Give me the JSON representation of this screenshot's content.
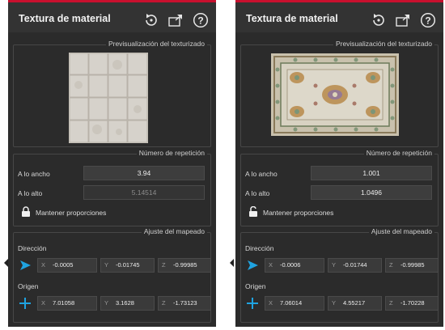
{
  "accent_color": "#c8102e",
  "direction_icon_color": "#1fa3e0",
  "origin_icon_color": "#1fa3e0",
  "left_panel": {
    "title": "Textura de material",
    "header_icons": [
      "reset-icon",
      "export-icon",
      "help-icon"
    ],
    "preview_label": "Previsualización del texturizado",
    "repeat_label": "Número de repetición",
    "width_label": "A lo ancho",
    "width_value": "3.94",
    "height_label": "A lo alto",
    "height_value": "5.14514",
    "keep_proportions_label": "Mantener proporciones",
    "keep_proportions_locked": true,
    "mapping_label": "Ajuste del mapeado",
    "direction_label": "Dirección",
    "direction": {
      "x": "-0.0005",
      "y": "-0.01745",
      "z": "-0.99985"
    },
    "origin_label": "Origen",
    "origin": {
      "x": "7.01058",
      "y": "3.1628",
      "z": "-1.73123"
    },
    "axis_x": "X",
    "axis_y": "Y",
    "axis_z": "Z"
  },
  "right_panel": {
    "title": "Textura de material",
    "header_icons": [
      "reset-icon",
      "export-icon",
      "help-icon"
    ],
    "preview_label": "Previsualización del texturizado",
    "repeat_label": "Número de repetición",
    "width_label": "A lo ancho",
    "width_value": "1.001",
    "height_label": "A lo alto",
    "height_value": "1.0496",
    "keep_proportions_label": "Mantener proporciones",
    "keep_proportions_locked": false,
    "mapping_label": "Ajuste del mapeado",
    "direction_label": "Dirección",
    "direction": {
      "x": "-0.0006",
      "y": "-0.01744",
      "z": "-0.99985"
    },
    "origin_label": "Origen",
    "origin": {
      "x": "7.06014",
      "y": "4.55217",
      "z": "-1.70228"
    },
    "axis_x": "X",
    "axis_y": "Y",
    "axis_z": "Z"
  }
}
